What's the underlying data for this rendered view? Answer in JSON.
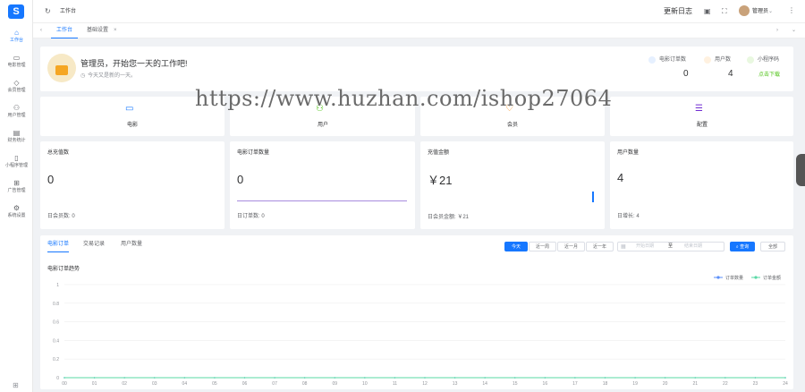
{
  "sidebar": {
    "items": [
      {
        "icon": "home-icon",
        "glyph": "⌂",
        "label": "工作台",
        "active": true
      },
      {
        "icon": "film-icon",
        "glyph": "▭",
        "label": "电影管理"
      },
      {
        "icon": "vip-icon",
        "glyph": "◇",
        "label": "会员管理"
      },
      {
        "icon": "user-icon",
        "glyph": "⚇",
        "label": "用户管理"
      },
      {
        "icon": "finance-icon",
        "glyph": "▤",
        "label": "财务统计"
      },
      {
        "icon": "mobile-icon",
        "glyph": "▯",
        "label": "小程序管理"
      },
      {
        "icon": "ad-icon",
        "glyph": "⊞",
        "label": "广告管理"
      },
      {
        "icon": "system-icon",
        "glyph": "⚙",
        "label": "系统设置"
      }
    ],
    "bottom_icon": "grid-icon"
  },
  "topbar": {
    "refresh_icon": "refresh-icon",
    "title": "工作台",
    "changelog": "更新日志",
    "username": "管理员"
  },
  "tabs": [
    {
      "label": "工作台",
      "active": true
    },
    {
      "label": "基础设置",
      "active": false
    }
  ],
  "welcome": {
    "greeting": "管理员，开始您一天的工作吧!",
    "subtitle": "今天又是新的一天。",
    "stats": [
      {
        "icon": "film-order-icon",
        "label": "电影订单数",
        "value": "0",
        "color": "#1677ff"
      },
      {
        "icon": "users-icon",
        "label": "用户数",
        "value": "4",
        "color": "#fa8c16"
      },
      {
        "icon": "miniapp-icon",
        "label": "小程序码",
        "value": "点击下载",
        "color": "#52c41a",
        "is_link": true
      }
    ]
  },
  "shortcuts": [
    {
      "icon": "movie-icon",
      "label": "电影",
      "color": "#1677ff"
    },
    {
      "icon": "user-group-icon",
      "label": "用户",
      "color": "#52c41a"
    },
    {
      "icon": "member-icon",
      "label": "会员",
      "color": "#fa8c16"
    },
    {
      "icon": "settings-icon",
      "label": "配置",
      "color": "#722ed1"
    }
  ],
  "metrics": [
    {
      "title": "总充值数",
      "value": "0",
      "footer": "日会员数: 0"
    },
    {
      "title": "电影订单数量",
      "value": "0",
      "footer": "日订单数: 0"
    },
    {
      "title": "充值金额",
      "value": "￥21",
      "footer": "日会员金额: ￥21"
    },
    {
      "title": "用户数量",
      "value": "4",
      "footer": "日增长: 4"
    }
  ],
  "panel": {
    "tabs": [
      "电影订单",
      "交易记录",
      "用户数量"
    ],
    "ranges": [
      "今天",
      "近一周",
      "近一月",
      "近一年"
    ],
    "date_start_placeholder": "开始日期",
    "date_sep": "至",
    "date_end_placeholder": "结束日期",
    "search_label": "查询",
    "all_label": "全部"
  },
  "chart_data": {
    "type": "line",
    "title": "电影订单趋势",
    "categories": [
      "00",
      "01",
      "02",
      "03",
      "04",
      "05",
      "06",
      "07",
      "08",
      "09",
      "10",
      "11",
      "12",
      "13",
      "14",
      "15",
      "16",
      "17",
      "18",
      "19",
      "20",
      "21",
      "22",
      "23",
      "24"
    ],
    "series": [
      {
        "name": "订单数量",
        "color": "#5b8ff9",
        "values": [
          0,
          0,
          0,
          0,
          0,
          0,
          0,
          0,
          0,
          0,
          0,
          0,
          0,
          0,
          0,
          0,
          0,
          0,
          0,
          0,
          0,
          0,
          0,
          0,
          0
        ]
      },
      {
        "name": "订单金额",
        "color": "#5ad8a6",
        "values": [
          0,
          0,
          0,
          0,
          0,
          0,
          0,
          0,
          0,
          0,
          0,
          0,
          0,
          0,
          0,
          0,
          0,
          0,
          0,
          0,
          0,
          0,
          0,
          0,
          0
        ]
      }
    ],
    "yticks": [
      "1",
      "0.8",
      "0.6",
      "0.4",
      "0.2",
      "0"
    ],
    "ylim": [
      0,
      1
    ],
    "legend": "top-right",
    "grid": true
  },
  "watermark": "https://www.huzhan.com/ishop27064"
}
